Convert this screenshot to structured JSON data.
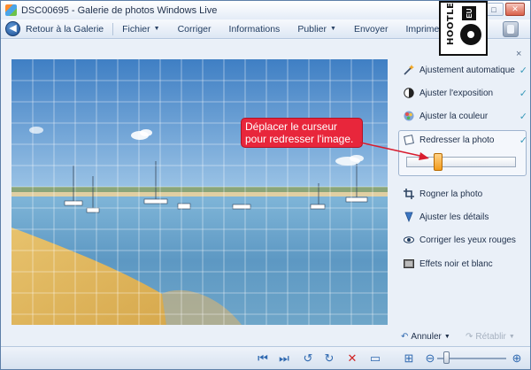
{
  "window": {
    "title": "DSC00695 - Galerie de photos Windows Live"
  },
  "window_controls": {
    "minimize": "–",
    "maximize": "□",
    "close": "✕"
  },
  "toolbar": {
    "back_label": "Retour à la Galerie",
    "items": [
      {
        "label": "Fichier",
        "has_dropdown": true
      },
      {
        "label": "Corriger",
        "has_dropdown": false
      },
      {
        "label": "Informations",
        "has_dropdown": false
      },
      {
        "label": "Publier",
        "has_dropdown": true
      },
      {
        "label": "Envoyer",
        "has_dropdown": false
      },
      {
        "label": "Imprimer",
        "has_dropdown": true
      }
    ],
    "overflow": "»",
    "caret": "▼"
  },
  "badge": {
    "text": "HOOTLE",
    "suffix": "EU"
  },
  "panel": {
    "close": "×",
    "tools": [
      {
        "label": "Ajustement automatique",
        "icon": "magic-wand-icon",
        "done": true
      },
      {
        "label": "Ajuster l'exposition",
        "icon": "exposure-icon",
        "done": true
      },
      {
        "label": "Ajuster la couleur",
        "icon": "color-palette-icon",
        "done": true
      },
      {
        "label": "Redresser la photo",
        "icon": "straighten-icon",
        "done": true
      },
      {
        "label": "Rogner la photo",
        "icon": "crop-icon",
        "done": false
      },
      {
        "label": "Ajuster les détails",
        "icon": "details-icon",
        "done": false
      },
      {
        "label": "Corriger les yeux rouges",
        "icon": "red-eye-icon",
        "done": false
      },
      {
        "label": "Effets noir et blanc",
        "icon": "black-white-icon",
        "done": false
      }
    ],
    "check_glyph": "✓",
    "straighten_level": 0.27,
    "undo_label": "Annuler",
    "redo_label": "Rétablir"
  },
  "callout": {
    "text": "Déplacer le curseur pour redresser l'image."
  },
  "bottom_toolbar": {
    "buttons": [
      "first-icon",
      "next-icon",
      "rotate-left-icon",
      "rotate-right-icon",
      "delete-icon",
      "slideshow-icon",
      "fit-icon",
      "zoom-out-icon",
      "zoom-in-icon"
    ],
    "zoom_level": 0.1
  },
  "colors": {
    "accent": "#2f69b0",
    "callout": "#e8263b",
    "check": "#3a9aba",
    "slider_thumb": "#f29b1a"
  }
}
